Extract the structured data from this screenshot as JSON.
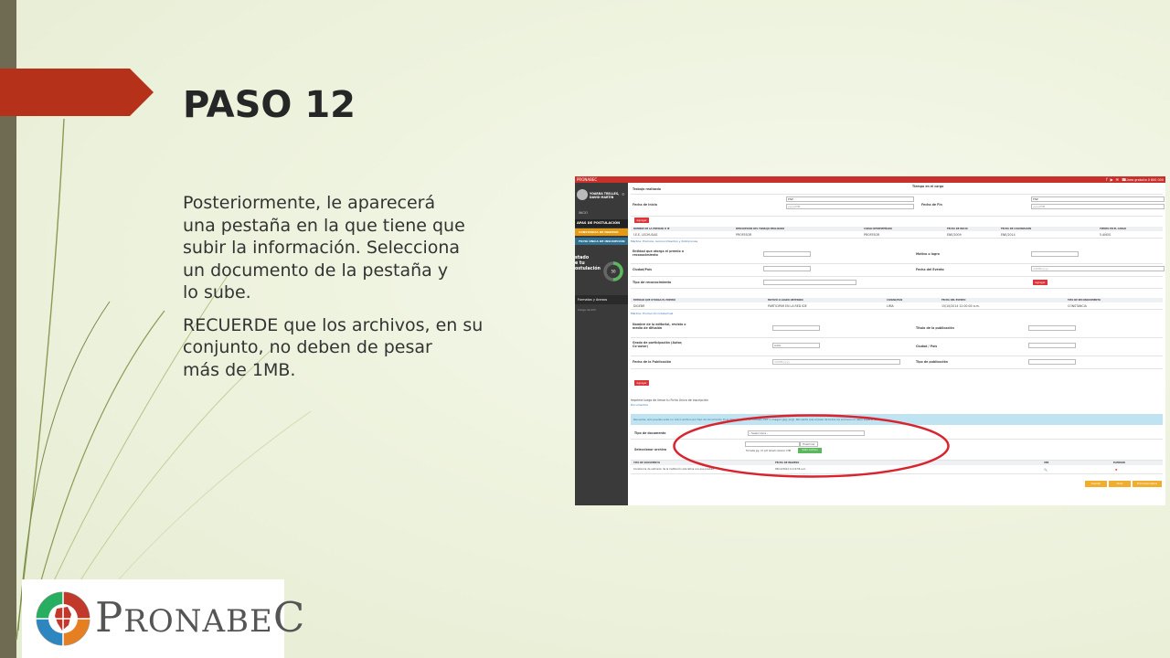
{
  "slide": {
    "title": "PASO 12",
    "paragraph1_lines": [
      "Posteriormente, le aparecerá",
      "una pestaña en la que tiene que",
      "subir la información. Selecciona",
      "un documento de la pestaña y",
      "lo sube."
    ],
    "paragraph2_lines": [
      "RECUERDE que los archivos, en su",
      "conjunto, no deben de pesar",
      "más de 1MB."
    ],
    "accent_color": "#b5311a",
    "logo": {
      "big_p": "P",
      "middle": "RONABE",
      "big_c": "C"
    }
  },
  "screenshot": {
    "topbar": {
      "logo": "PRONABEC",
      "icons": [
        "facebook-icon",
        "youtube-icon",
        "mail-icon",
        "phone-icon"
      ],
      "hotline": "Línea gratuita 0 800 000"
    },
    "sidebar": {
      "user_name_line1": "YOARRA TRELLES,",
      "user_name_line2": "DAVID MARTIN",
      "inicio": "INICIO",
      "section_title": "APAS DE POSTULACIÓN",
      "items": [
        "CONSTANCIA DE INGRESO",
        "FICHA ÚNICA DE INSCRIPCIÓN"
      ],
      "estado_lines": [
        "stado",
        "e tu",
        "ostulación"
      ],
      "progress_value": 50,
      "progress_label": "50",
      "formatos": "Formatos y Anexos",
      "carga": "Carga de Info"
    },
    "content": {
      "trabajo_label": "Trabajo realizado",
      "tiempo_cargo_label": "Tiempo en el cargo",
      "fecha_inicio_label": "Fecha de Inicio",
      "fecha_fin_label": "Fecha de Fin",
      "select_value": "ENE",
      "date_placeholder": "yyyy/MM",
      "agregar": "Agregar",
      "table1_headers": [
        "NOMBRE DE LA ENTIDAD O IE",
        "DESCRIPCIÓN DEL TRABAJO REALIZADO",
        "CARGO DESEMPEÑADO",
        "FECHA DE INICIO",
        "FECHA DE CULMINACIÓN",
        "TIEMPO EN EL CARGO"
      ],
      "table1_row": [
        "I.E.E. LECHUGAS",
        "PROFESOR",
        "PROFESOR",
        "ENE/2009",
        "ENE/2014",
        "5 AÑOS"
      ],
      "section_premios": "Méritos: Premios, reconocimientos y distinciones",
      "entidad_premio_label": "Entidad que otorga el premio o reconocimiento",
      "motivo_label": "Motivo o logro",
      "ciudad_label": "Ciudad/País",
      "fecha_evento_label": "Fecha del Evento",
      "tipo_reconocimiento_label": "Tipo de reconocimiento",
      "evento_placeholder": "dd/MM/yyyy",
      "table2_headers": [
        "ENTIDAD QUE OTORGA EL PREMIO",
        "MOTIVO O LOGRO OBTENIDO",
        "CIUDAD/PAÍS",
        "FECHA DEL EVENTO",
        "TIPO DE RECONOCIMIENTO"
      ],
      "table2_row": [
        "DIGEBR",
        "PARTICIPAR EN LA RED IDE",
        "LIMA",
        "15/10/2014 12:00:00 a.m.",
        "CONSTANCIA"
      ],
      "section_produccion": "Méritos: Producción intelectual",
      "editorial_label": "Nombre de la editorial, revista o medio de difusión",
      "titulo_pub_label": "Título de la publicación",
      "grado_label": "Grado de participación (Autor, Co-autor)",
      "ciudad_pais_label": "Ciudad / País",
      "autor_value": "Autor",
      "fecha_pub_label": "Fecha de la Publicación",
      "tipo_pub_label": "Tipo de publicación",
      "note_line": "Imprime luego de llenar tu Ficha Única de Inscripción",
      "documentos_link": "Documentos",
      "info_text": "Recuerde, solo puedes subir un único archivo por tipo de documento. El archivo debe ser en formato PDF o imagen (jpg, png). Recuerde que el peso de todos los archivos no debe superar 1MB.",
      "tipo_doc_label": "Tipo de documento",
      "tipo_doc_value": "- Seleccione -",
      "sel_archivo_label": "Seleccionar archivo",
      "examinar": "Examinar",
      "formats_hint": "Formatos jpg, .tif, pdf, tamaño máximo 1 MB",
      "subir": "Subir Archivo",
      "table3_headers": [
        "TIPO DE DOCUMENTO",
        "FECHA DE INGRESO",
        "VER",
        "ELIMINAR"
      ],
      "table3_row": [
        "Constancia de admisión de la Institución educativa a la que postula",
        "09/12/2014 11:19:56 a.m."
      ],
      "buttons": [
        "Guardar",
        "Atrás",
        "Ficha Descriptiva"
      ]
    },
    "highlight_color": "#d9232e"
  }
}
